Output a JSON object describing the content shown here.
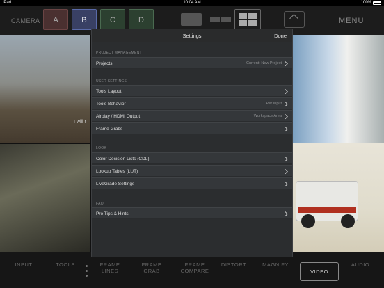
{
  "status_bar": {
    "device": "iPad",
    "time": "10:04 AM",
    "battery": "100%"
  },
  "top_bar": {
    "camera_label": "CAMERA",
    "cameras": [
      "A",
      "B",
      "C",
      "D"
    ],
    "selected_camera": "B",
    "menu_label": "MENU"
  },
  "background": {
    "subtitle": "I will r"
  },
  "bottom_bar": {
    "tools": [
      "INPUT",
      "TOOLS",
      "FRAME\nLINES",
      "FRAME\nGRAB",
      "FRAME\nCOMPARE",
      "DISTORT",
      "MAGNIFY",
      "VIDEO",
      "AUDIO"
    ],
    "active_tool": "VIDEO"
  },
  "settings": {
    "title": "Settings",
    "done_label": "Done",
    "sections": [
      {
        "header": "PROJECT MANAGEMENT",
        "rows": [
          {
            "label": "Projects",
            "value": "Current: New Project"
          }
        ]
      },
      {
        "header": "USER SETTINGS",
        "rows": [
          {
            "label": "Tools Layout",
            "value": ""
          },
          {
            "label": "Tools Behavior",
            "value": "Per Input"
          },
          {
            "label": "Airplay / HDMI Output",
            "value": "Workspace Area"
          },
          {
            "label": "Frame Grabs",
            "value": ""
          }
        ]
      },
      {
        "header": "LOOK",
        "rows": [
          {
            "label": "Color Decision Lists  (CDL)",
            "value": ""
          },
          {
            "label": "Lookup Tables  (LUT)",
            "value": ""
          },
          {
            "label": "LiveGrade Settings",
            "value": ""
          }
        ]
      },
      {
        "header": "FAQ",
        "rows": [
          {
            "label": "Pro Tips & Hints",
            "value": ""
          }
        ]
      }
    ]
  }
}
